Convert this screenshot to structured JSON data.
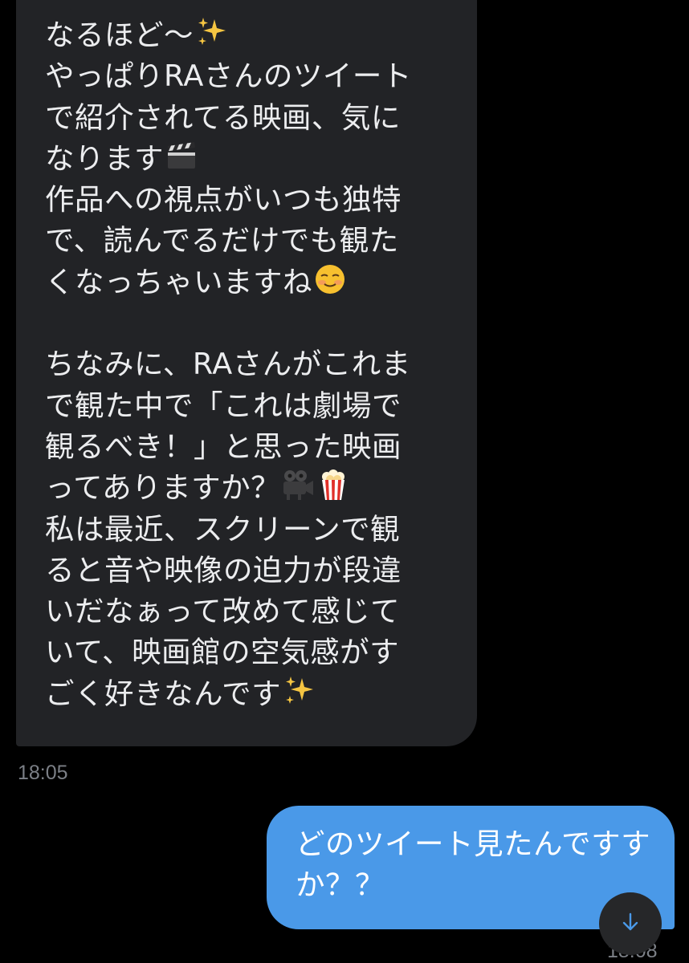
{
  "incoming_message": {
    "lines": [
      "なるほど〜",
      "やっぱりRAさんのツイート",
      "で紹介されてる映画、気に",
      "なります",
      "作品への視点がいつも独特",
      "で、読んでるだけでも観た",
      "くなっちゃいますね",
      "",
      "ちなみに、RAさんがこれま",
      "で観た中で「これは劇場で",
      "観るべき！」と思った映画",
      "ってありますか？",
      "私は最近、スクリーンで観",
      "ると音や映像の迫力が段違",
      "いだなぁって改めて感じて",
      "いて、映画館の空気感がす",
      "ごく好きなんです"
    ],
    "emojis": {
      "line1": "sparkles-emoji",
      "line4": "clapper-board-emoji",
      "line7": "smiling-face-emoji",
      "line12a": "movie-camera-emoji",
      "line12b": "popcorn-emoji",
      "line17": "sparkles-emoji"
    },
    "timestamp": "18:05"
  },
  "outgoing_message": {
    "lines": [
      "どのツイート見たんですす",
      "か？？"
    ],
    "timestamp": "18:08"
  },
  "colors": {
    "background": "#000000",
    "incoming_bubble": "#222326",
    "outgoing_bubble": "#4a99e8",
    "timestamp": "#7b7f86"
  },
  "scroll_button": {
    "icon": "arrow-down-icon"
  }
}
